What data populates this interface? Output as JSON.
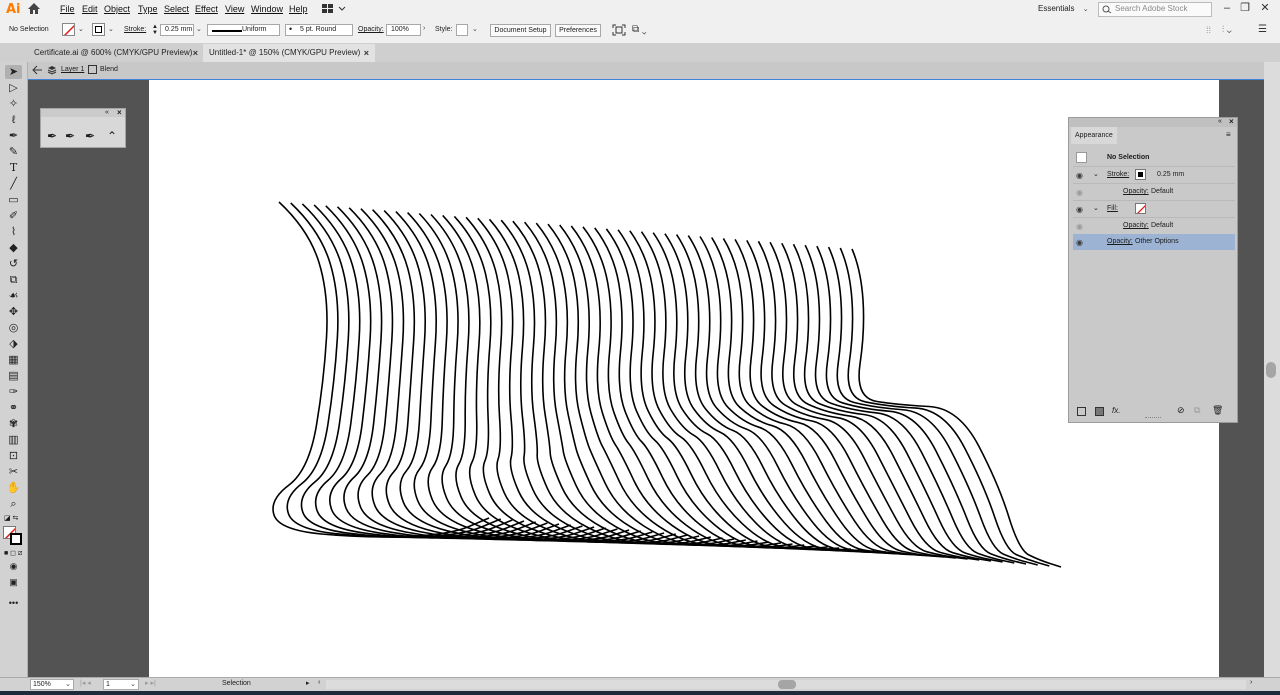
{
  "app": {
    "logo": "Ai"
  },
  "menu": [
    "File",
    "Edit",
    "Object",
    "Type",
    "Select",
    "Effect",
    "View",
    "Window",
    "Help"
  ],
  "workspace": {
    "label": "Essentials"
  },
  "search": {
    "placeholder": "Search Adobe Stock"
  },
  "control": {
    "selection": "No Selection",
    "stroke_label": "Stroke:",
    "stroke_weight": "0.25 mm",
    "profile": "Uniform",
    "brush": "5 pt. Round",
    "opacity_label": "Opacity:",
    "opacity": "100%",
    "style_label": "Style:",
    "doc_setup": "Document Setup",
    "preferences": "Preferences"
  },
  "tabs": [
    {
      "label": "Certificate.ai @ 600% (CMYK/GPU Preview)",
      "close": "×"
    },
    {
      "label": "Untitled-1* @ 150% (CMYK/GPU Preview)",
      "close": "×"
    }
  ],
  "breadcrumb": {
    "layer": "Layer 1",
    "group": "Blend"
  },
  "appearance": {
    "title": "Appearance",
    "selection": "No Selection",
    "stroke_label": "Stroke:",
    "stroke_value": "0.25 mm",
    "opacity_label": "Opacity:",
    "opacity_default": "Default",
    "fill_label": "Fill:",
    "other_options": "Other Options",
    "fx": "fx."
  },
  "status": {
    "zoom": "150%",
    "page": "1",
    "tool": "Selection"
  },
  "colors": {
    "accent": "#ff7c00",
    "highlight": "#9db3d4",
    "guide": "#3d84d8"
  }
}
